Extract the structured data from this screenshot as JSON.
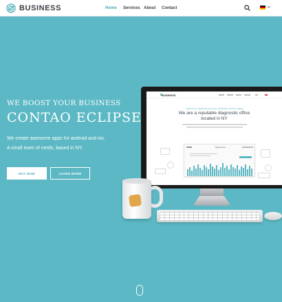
{
  "brand": {
    "name": "BUSINESS",
    "accent": "#4aa9b7",
    "hero_bg": "#5bb8c4"
  },
  "nav": {
    "items": [
      {
        "label": "Home",
        "active": true
      },
      {
        "label": "Services",
        "active": false
      },
      {
        "label": "About",
        "active": false
      },
      {
        "label": "Contact",
        "active": false
      }
    ],
    "search_icon": "search-icon",
    "language_icon": "german-flag-icon"
  },
  "hero": {
    "kicker": "WE BOOST YOUR BUSINESS",
    "title": "CONTAO ECLIPSE",
    "line1": "We create awesome apps for android and ios.",
    "line2": "A small team of nerds, based in NY.",
    "primary_button": "BUY NOW",
    "secondary_button": "LEARN MORE"
  },
  "mockup": {
    "logo": "BUSINESS",
    "kicker": "A BEAUTIFUL RESPONSIVE MULTI-PURPOSE CONTAO THEME",
    "title_line1": "We are a reputable diagnostic office",
    "title_line2": "located in NY",
    "card_title": "Track the bar"
  }
}
